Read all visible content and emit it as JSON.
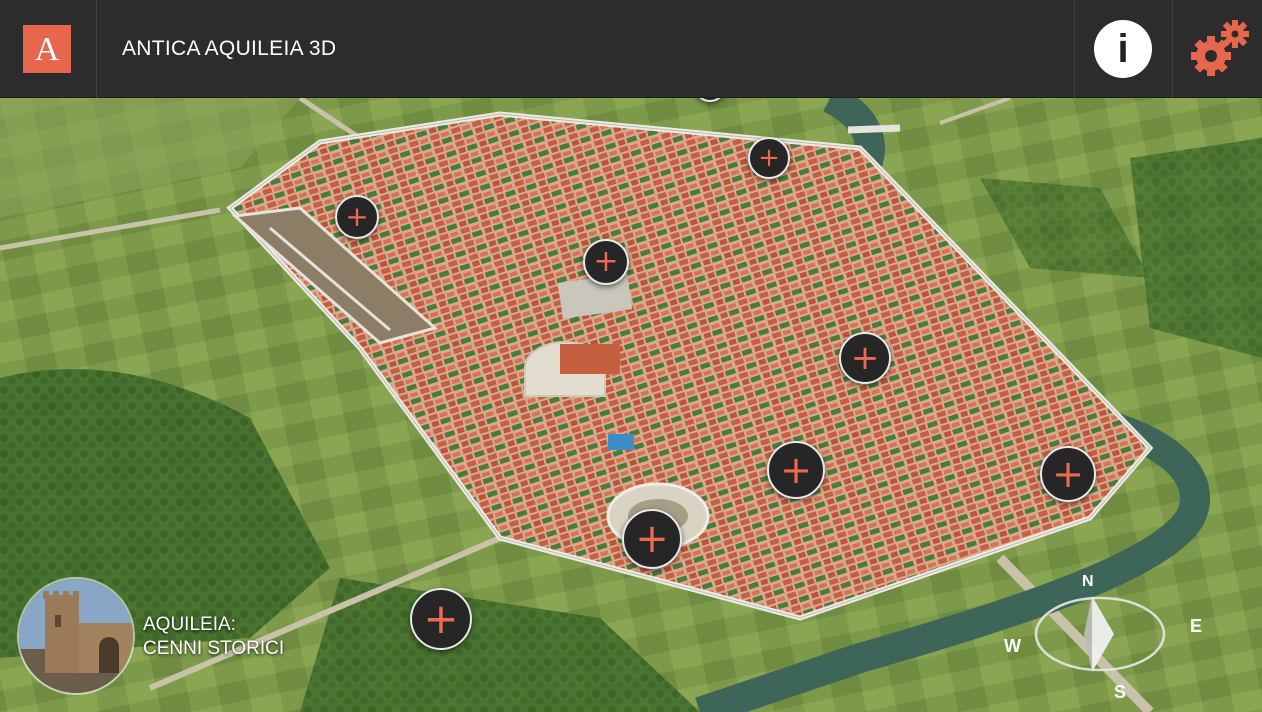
{
  "header": {
    "logo_letter": "A",
    "title": "ANTICA AQUILEIA 3D",
    "info_label": "i",
    "info_icon": "info-icon",
    "settings_icon": "gears-icon",
    "accent": "#e8664d"
  },
  "map": {
    "poi_label": "+",
    "poi_count": 10
  },
  "compass": {
    "n": "N",
    "e": "E",
    "s": "S",
    "w": "W"
  },
  "history": {
    "line1": "AQUILEIA:",
    "line2": "CENNI STORICI"
  }
}
